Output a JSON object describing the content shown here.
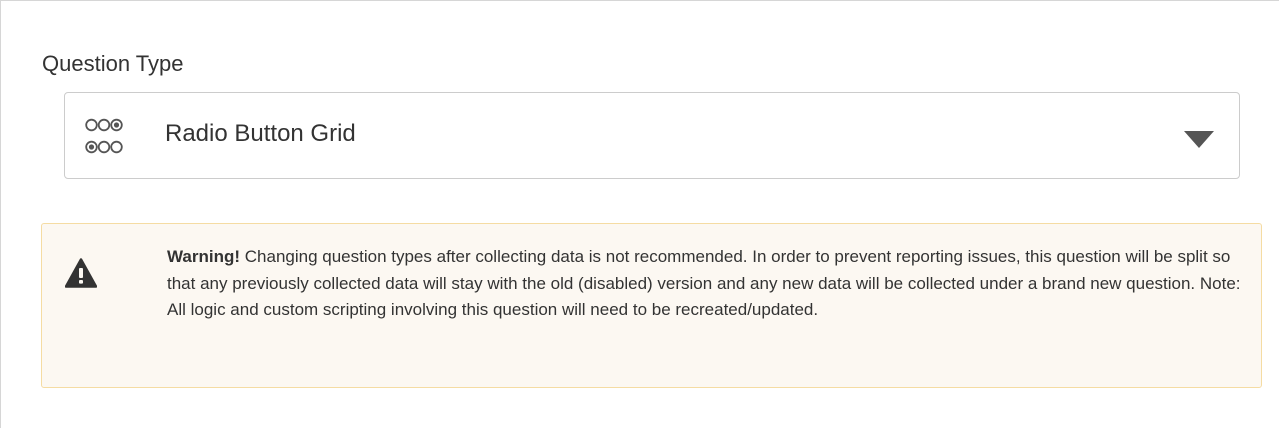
{
  "question_type": {
    "label": "Question Type",
    "selected_value": "Radio Button Grid",
    "selected_icon": "radio-button-grid-icon",
    "dropdown_icon": "caret-down-icon"
  },
  "warning": {
    "icon": "warning-triangle-icon",
    "title": "Warning!",
    "message": " Changing question types after collecting data is not recommended. In order to prevent reporting issues, this question will be split so that any previously collected data will stay with the old (disabled) version and any new data will be collected under a brand new question. Note: All logic and custom scripting involving this question will need to be recreated/updated."
  },
  "colors": {
    "warning_background": "#fcf8f2",
    "warning_border": "#f5dca3",
    "text": "#333333"
  }
}
